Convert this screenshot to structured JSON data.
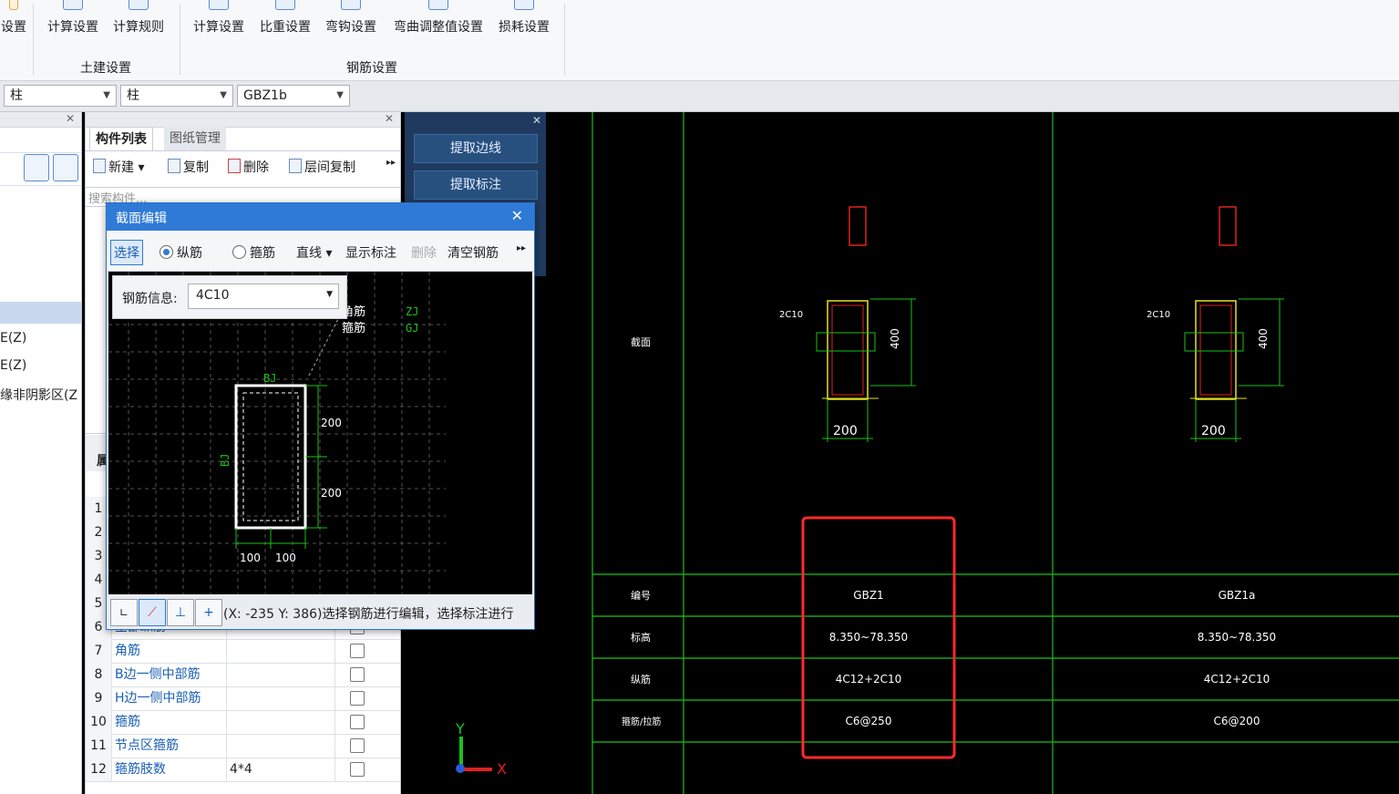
{
  "ribbon": {
    "left_cut_label": "设置",
    "civil_group": {
      "label": "土建设置",
      "buttons": [
        "计算设置",
        "计算规则"
      ]
    },
    "rebar_group": {
      "label": "钢筋设置",
      "buttons": [
        "计算设置",
        "比重设置",
        "弯钩设置",
        "弯曲调整值设置",
        "损耗设置"
      ]
    }
  },
  "selectors": {
    "floor": "柱",
    "type": "柱",
    "component": "GBZ1b"
  },
  "left_tree": {
    "items": [
      "E(Z)",
      "E(Z)",
      "缘非阴影区(Z"
    ]
  },
  "component_panel": {
    "tabs": [
      "构件列表",
      "图纸管理"
    ],
    "toolbar": {
      "new": "新建",
      "copy": "复制",
      "delete": "删除",
      "floor_copy": "层间复制"
    },
    "search_placeholder": "搜索构件...",
    "props_header": "属",
    "rows": [
      {
        "num": "1",
        "name": "",
        "value": ""
      },
      {
        "num": "2",
        "name": "",
        "value": ""
      },
      {
        "num": "3",
        "name": "",
        "value": ""
      },
      {
        "num": "4",
        "name": "",
        "value": ""
      },
      {
        "num": "5",
        "name": "",
        "value": ""
      },
      {
        "num": "6",
        "name": "全部纵筋",
        "value": ""
      },
      {
        "num": "7",
        "name": "角筋",
        "value": ""
      },
      {
        "num": "8",
        "name": "B边一侧中部筋",
        "value": ""
      },
      {
        "num": "9",
        "name": "H边一侧中部筋",
        "value": ""
      },
      {
        "num": "10",
        "name": "箍筋",
        "value": ""
      },
      {
        "num": "11",
        "name": "节点区箍筋",
        "value": ""
      },
      {
        "num": "12",
        "name": "箍筋肢数",
        "value": "4*4"
      }
    ]
  },
  "blue_panel": {
    "buttons": [
      "提取边线",
      "提取标注"
    ]
  },
  "dialog": {
    "title": "截面编辑",
    "toolbar": {
      "select": "选择",
      "radio_long": "纵筋",
      "radio_stirrup": "箍筋",
      "line": "直线",
      "show_label": "显示标注",
      "delete": "删除",
      "clear": "清空钢筋"
    },
    "rebar_info_label": "钢筋信息:",
    "rebar_info_value": "4C10",
    "canvas": {
      "legend1": "角筋",
      "legend2": "箍筋",
      "legend_code1": "ZJ",
      "legend_code2": "GJ",
      "top_label": "BJ",
      "side_label": "BJ",
      "dim_h1": "200",
      "dim_h2": "200",
      "dim_w1": "100",
      "dim_w2": "100"
    },
    "status_text": "(X: -235 Y: 386)选择钢筋进行编辑，选择标注进行"
  },
  "cad": {
    "row_labels": [
      "截面",
      "编号",
      "标高",
      "纵筋",
      "箍筋/拉筋"
    ],
    "col1": {
      "id": "GBZ1",
      "elevation": "8.350~78.350",
      "longitudinal": "4C12+2C10",
      "stirrup": "C6@250",
      "label_2c10": "2C10",
      "dim_400": "400",
      "dim_200": "200"
    },
    "col2": {
      "id": "GBZ1a",
      "elevation": "8.350~78.350",
      "longitudinal": "4C12+2C10",
      "stirrup": "C6@200",
      "label_2c10": "2C10",
      "dim_400": "400",
      "dim_200": "200"
    },
    "axis_y": "Y",
    "axis_x": "X"
  }
}
